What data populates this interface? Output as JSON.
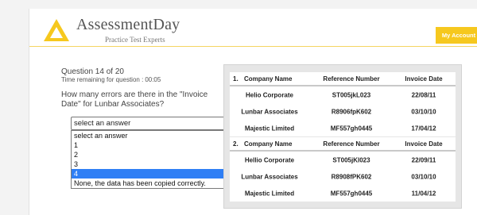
{
  "header": {
    "brand": "AssessmentDay",
    "tagline": "Practice Test Experts",
    "account_button": "My Account"
  },
  "question": {
    "number_text": "Question 14 of 20",
    "timer_label": "Time remaining for question :",
    "timer_value": "00:05",
    "text": "How many errors are there in the \"Invoice Date\" for Lunbar Associates?"
  },
  "answer_select": {
    "value": "select an answer",
    "options": [
      "select an answer",
      "1",
      "2",
      "3",
      "4",
      "None, the data has been copied correctly."
    ],
    "highlighted": "4"
  },
  "tables": [
    {
      "number": "1.",
      "headers": {
        "company": "Company Name",
        "reference": "Reference Number",
        "date": "Invoice Date"
      },
      "rows": [
        {
          "company": "Helio Corporate",
          "reference": "ST005jkL023",
          "date": "22/08/11"
        },
        {
          "company": "Lunbar Associates",
          "reference": "R8906fpK602",
          "date": "03/10/10"
        },
        {
          "company": "Majestic Limited",
          "reference": "MF557gh0445",
          "date": "17/04/12"
        }
      ]
    },
    {
      "number": "2.",
      "headers": {
        "company": "Company Name",
        "reference": "Reference Number",
        "date": "Invoice Date"
      },
      "rows": [
        {
          "company": "Hellio Corporate",
          "reference": "ST005jKl023",
          "date": "22/09/11"
        },
        {
          "company": "Lunbar Associates",
          "reference": "R8908fPK602",
          "date": "03/10/10"
        },
        {
          "company": "Majestic Limited",
          "reference": "MF557gh0445",
          "date": "11/04/12"
        }
      ]
    }
  ],
  "colors": {
    "accent": "#f6c81e",
    "highlight": "#2f7ff5"
  },
  "icons": {
    "logo": "triangle-logo-icon",
    "dropdown": "chevron-down-icon"
  }
}
